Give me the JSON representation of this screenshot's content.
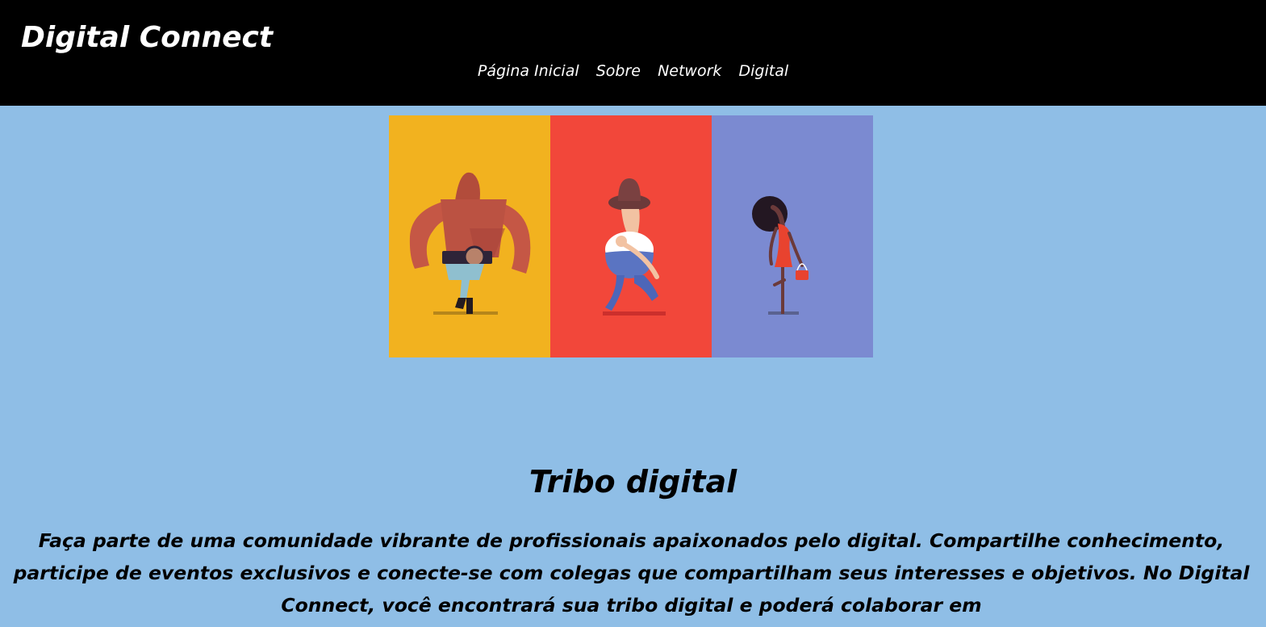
{
  "header": {
    "brand": "Digital Connect",
    "nav": [
      {
        "label": "Página Inicial"
      },
      {
        "label": "Sobre"
      },
      {
        "label": "Network"
      },
      {
        "label": "Digital"
      }
    ]
  },
  "hero": {
    "panels": [
      {
        "color": "#f2b21f",
        "figure": "wrestler-character"
      },
      {
        "color": "#f2473a",
        "figure": "cowboy-character"
      },
      {
        "color": "#7b8ad1",
        "figure": "woman-character"
      }
    ]
  },
  "main": {
    "title": "Tribo digital",
    "text": "Faça parte de uma comunidade vibrante de profissionais apaixonados pelo digital. Compartilhe conhecimento, participe de eventos exclusivos e conecte-se com colegas que compartilham seus interesses e objetivos. No Digital Connect, você encontrará sua tribo digital e poderá colaborar em"
  },
  "colors": {
    "page_background": "#8fbee6",
    "header_background": "#000000",
    "header_text": "#ffffff"
  }
}
